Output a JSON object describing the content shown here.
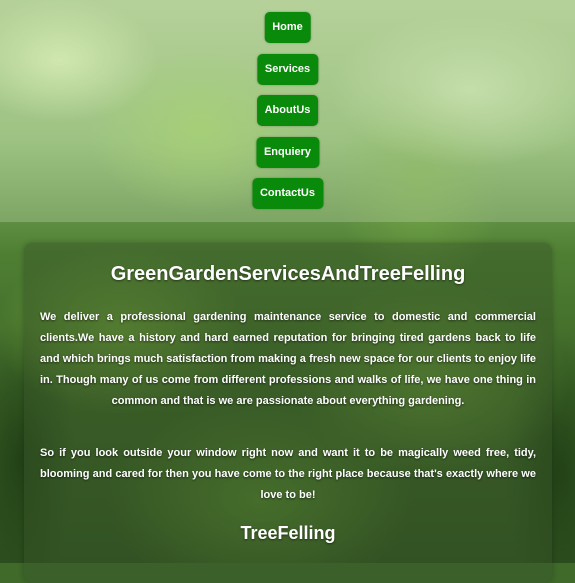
{
  "nav": {
    "items": [
      {
        "label": "Home"
      },
      {
        "label": "Services"
      },
      {
        "label": "AboutUs"
      },
      {
        "label": "Enquiery"
      },
      {
        "label": "ContactUs"
      }
    ]
  },
  "main": {
    "title": "GreenGardenServicesAndTreeFelling",
    "paragraph1": "We deliver a professional gardening maintenance service to domestic and commercial clients.We have a history and hard earned reputation for bringing tired gardens back to life and which brings much satisfaction from making a fresh new space for our clients to enjoy life in. Though many of us come from different professions and walks of life, we have one thing in common and that is we are passionate about everything gardening.",
    "paragraph2": "So if you look outside your window right now and want it to be magically weed free, tidy, blooming and cared for then you have come to the right place because that's exactly where we love to be!",
    "section_title": "TreeFelling"
  },
  "colors": {
    "nav_button": "#0a8a0a",
    "text": "#ffffff"
  }
}
